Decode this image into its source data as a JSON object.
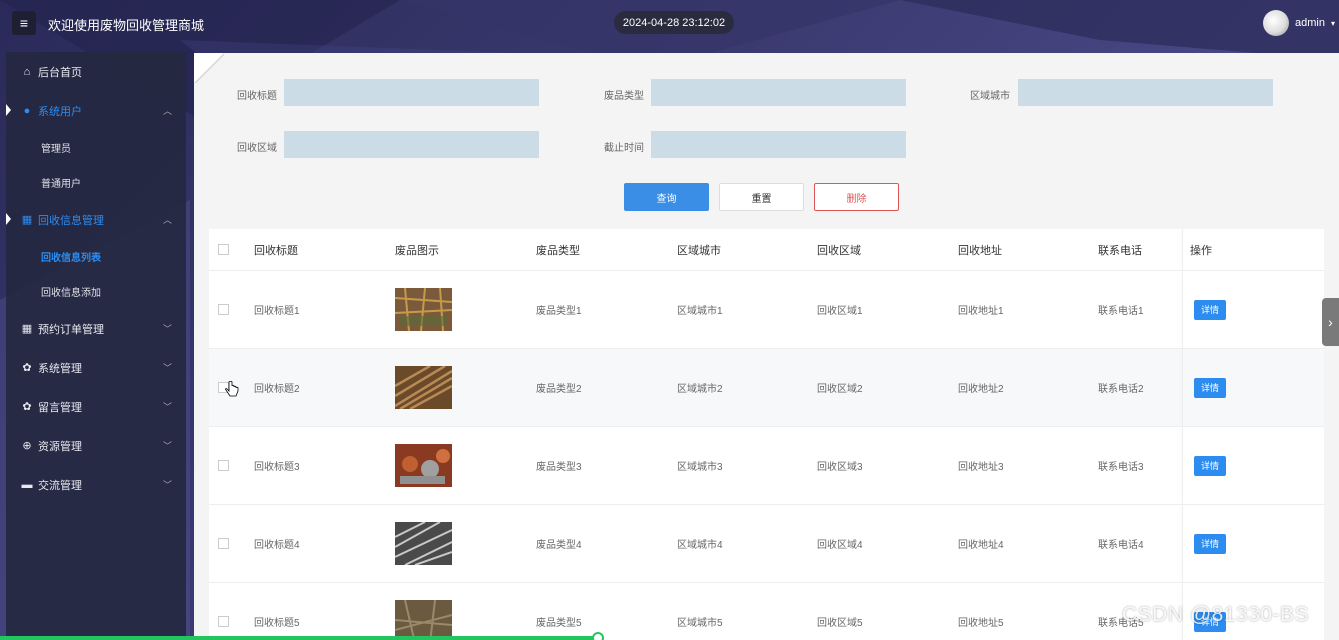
{
  "header": {
    "menu_icon": "hamburger-icon",
    "title": "欢迎使用废物回收管理商城",
    "datetime": "2024-04-28 23:12:02",
    "username": "admin"
  },
  "sidebar": {
    "items": [
      {
        "label": "后台首页",
        "icon": "home-icon"
      },
      {
        "label": "系统用户",
        "icon": "user-icon",
        "active": true,
        "children": [
          "管理员",
          "普通用户"
        ]
      },
      {
        "label": "回收信息管理",
        "icon": "grid-icon",
        "active": true,
        "children": [
          "回收信息列表",
          "回收信息添加"
        ]
      },
      {
        "label": "预约订单管理",
        "icon": "grid-icon"
      },
      {
        "label": "系统管理",
        "icon": "gear-icon"
      },
      {
        "label": "留言管理",
        "icon": "gear-icon"
      },
      {
        "label": "资源管理",
        "icon": "plus-icon"
      },
      {
        "label": "交流管理",
        "icon": "chat-icon"
      }
    ]
  },
  "search": {
    "title_label": "回收标题",
    "type_label": "废品类型",
    "city_label": "区域城市",
    "area_label": "回收区域",
    "deadline_label": "截止时间",
    "query_button": "查询",
    "reset_button": "重置",
    "delete_button": "删除"
  },
  "table": {
    "headers": [
      "回收标题",
      "废品图示",
      "废品类型",
      "区域城市",
      "回收区域",
      "回收地址",
      "联系电话",
      "操作"
    ],
    "detail_label": "详情",
    "rows": [
      {
        "title": "回收标题1",
        "type": "废品类型1",
        "city": "区域城市1",
        "area": "回收区域1",
        "address": "回收地址1",
        "phone": "联系电话1"
      },
      {
        "title": "回收标题2",
        "type": "废品类型2",
        "city": "区域城市2",
        "area": "回收区域2",
        "address": "回收地址2",
        "phone": "联系电话2"
      },
      {
        "title": "回收标题3",
        "type": "废品类型3",
        "city": "区域城市3",
        "area": "回收区域3",
        "address": "回收地址3",
        "phone": "联系电话3"
      },
      {
        "title": "回收标题4",
        "type": "废品类型4",
        "city": "区域城市4",
        "area": "回收区域4",
        "address": "回收地址4",
        "phone": "联系电话4"
      },
      {
        "title": "回收标题5",
        "type": "废品类型5",
        "city": "区域城市5",
        "area": "回收区域5",
        "address": "回收地址5",
        "phone": "联系电话5"
      }
    ]
  },
  "watermark": "CSDN @81330-BS",
  "colors": {
    "accent": "#2d8cf0",
    "danger": "#e35555",
    "input_bg": "#cbdce6"
  }
}
